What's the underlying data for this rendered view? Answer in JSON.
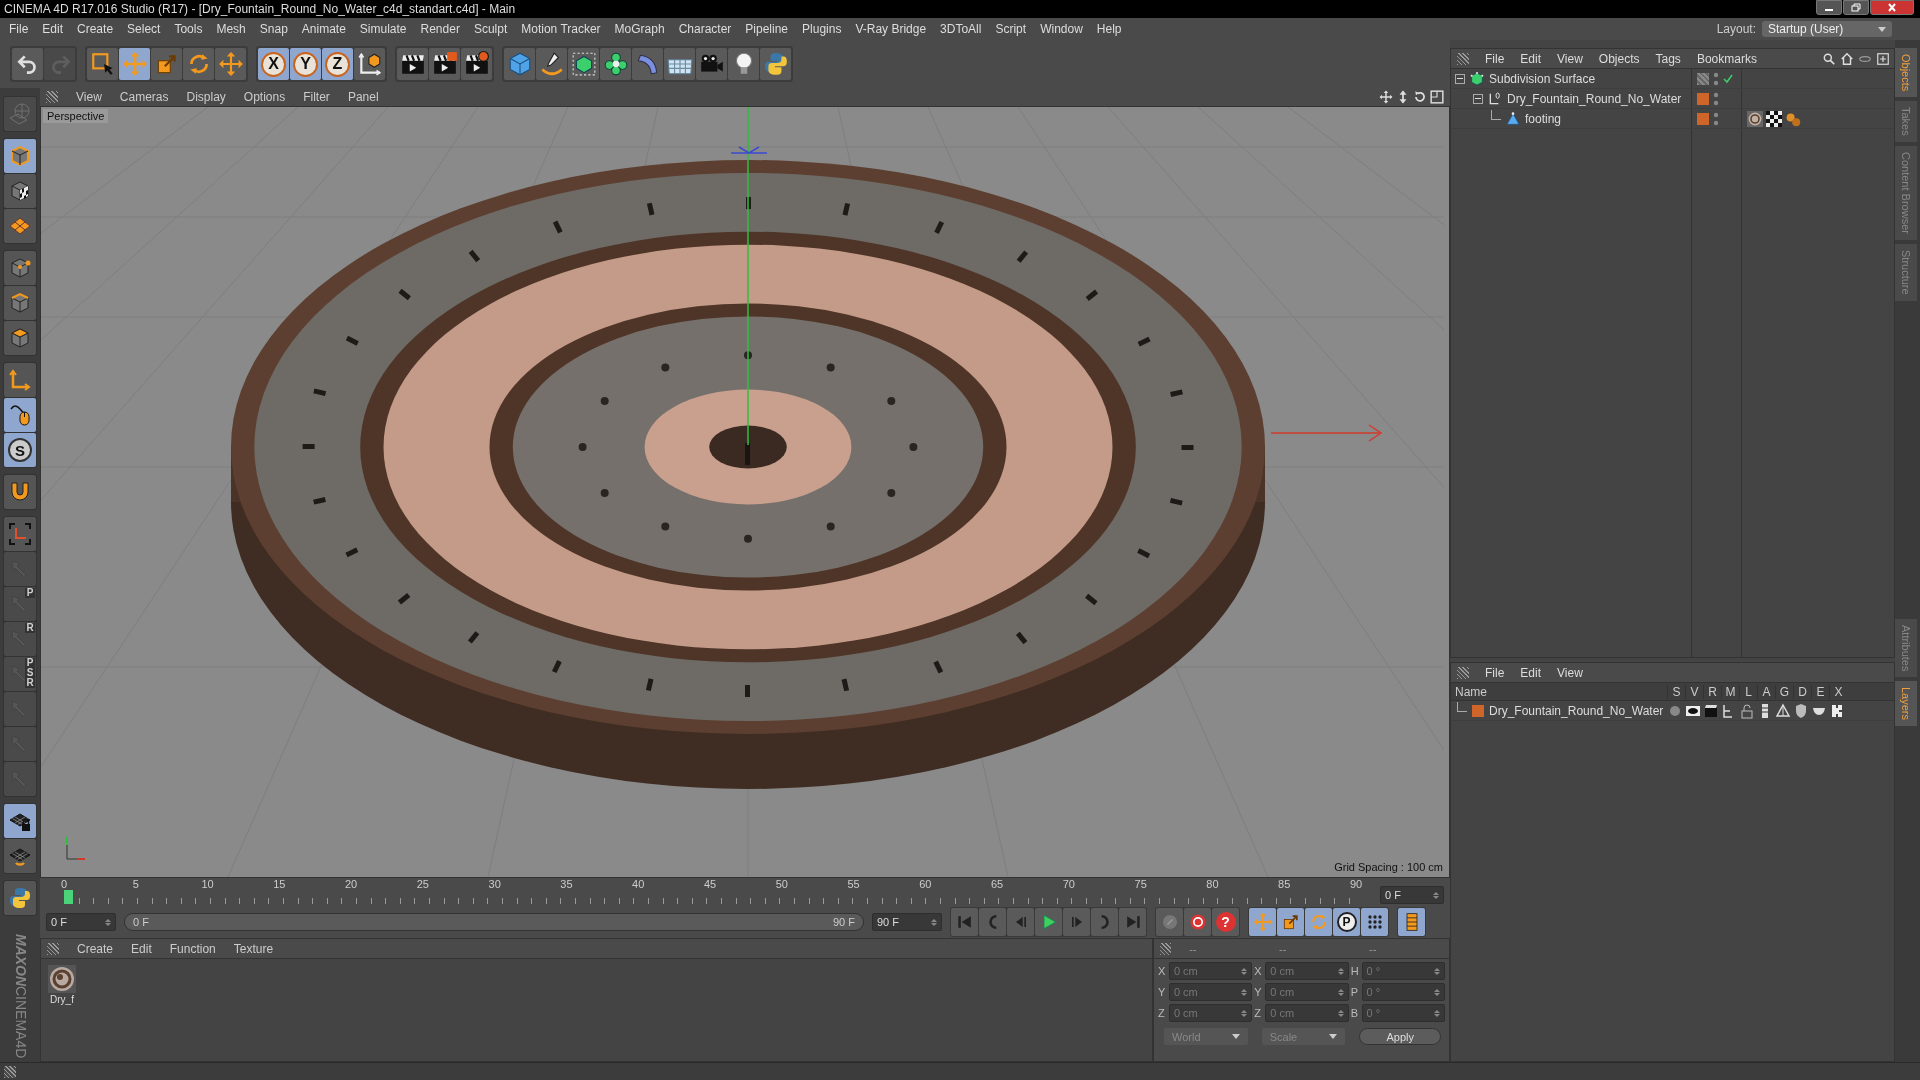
{
  "window": {
    "title": "CINEMA 4D R17.016 Studio (R17) - [Dry_Fountain_Round_No_Water_c4d_standart.c4d] - Main"
  },
  "menu_bar": [
    "File",
    "Edit",
    "Create",
    "Select",
    "Tools",
    "Mesh",
    "Snap",
    "Animate",
    "Simulate",
    "Render",
    "Sculpt",
    "Motion Tracker",
    "MoGraph",
    "Character",
    "Pipeline",
    "Plugins",
    "V-Ray Bridge",
    "3DToAll",
    "Script",
    "Window",
    "Help"
  ],
  "layout": {
    "label": "Layout:",
    "value": "Startup (User)"
  },
  "toolbar": {
    "groups": [
      [
        {
          "kind": "undo",
          "selected": false,
          "disabled": false
        },
        {
          "kind": "redo",
          "selected": false,
          "disabled": true
        }
      ],
      [
        {
          "kind": "select",
          "selected": false,
          "disabled": false
        },
        {
          "kind": "move",
          "selected": true,
          "disabled": false
        },
        {
          "kind": "scale",
          "selected": false,
          "disabled": false
        },
        {
          "kind": "rotate",
          "selected": false,
          "disabled": false
        },
        {
          "kind": "transform",
          "selected": false,
          "disabled": false
        }
      ],
      [
        {
          "kind": "axis",
          "label": "X",
          "selected": true,
          "disabled": false
        },
        {
          "kind": "axis",
          "label": "Y",
          "selected": true,
          "disabled": false
        },
        {
          "kind": "axis",
          "label": "Z",
          "selected": true,
          "disabled": false
        },
        {
          "kind": "coord",
          "selected": false,
          "disabled": false
        }
      ],
      [
        {
          "kind": "render",
          "selected": false,
          "disabled": false
        },
        {
          "kind": "render_pv",
          "selected": false,
          "disabled": false
        },
        {
          "kind": "render_settings",
          "selected": false,
          "disabled": false
        }
      ],
      [
        {
          "kind": "cube",
          "selected": false,
          "disabled": false
        },
        {
          "kind": "pen",
          "selected": false,
          "disabled": false
        },
        {
          "kind": "subdiv",
          "selected": false,
          "disabled": false
        },
        {
          "kind": "cloner",
          "selected": false,
          "disabled": false
        },
        {
          "kind": "bend",
          "selected": false,
          "disabled": false
        },
        {
          "kind": "floor",
          "selected": false,
          "disabled": false
        },
        {
          "kind": "camera",
          "selected": false,
          "disabled": false
        },
        {
          "kind": "light",
          "selected": false,
          "disabled": false
        },
        {
          "kind": "python",
          "selected": false,
          "disabled": false
        }
      ]
    ]
  },
  "left_toolbar": {
    "groups": [
      [
        {
          "kind": "globe",
          "selected": false,
          "disabled": true
        }
      ],
      [
        {
          "kind": "model",
          "selected": true,
          "disabled": false
        },
        {
          "kind": "texture",
          "selected": false,
          "disabled": false
        },
        {
          "kind": "workplane",
          "selected": false,
          "disabled": false
        }
      ],
      [
        {
          "kind": "points",
          "selected": false,
          "disabled": false
        },
        {
          "kind": "edges",
          "selected": false,
          "disabled": false
        },
        {
          "kind": "polys",
          "selected": false,
          "disabled": false
        }
      ],
      [
        {
          "kind": "axis_l",
          "selected": false,
          "disabled": false
        },
        {
          "kind": "mouse",
          "selected": true,
          "disabled": false
        },
        {
          "kind": "snap",
          "label": "S",
          "selected": true,
          "disabled": false
        }
      ],
      [
        {
          "kind": "magnet",
          "selected": false,
          "disabled": false
        }
      ],
      [
        {
          "kind": "axis_frame",
          "selected": false,
          "disabled": false
        },
        {
          "kind": "tool",
          "selected": false,
          "disabled": true
        },
        {
          "kind": "tool",
          "label": "P",
          "selected": false,
          "disabled": true
        },
        {
          "kind": "tool",
          "label": "R",
          "selected": false,
          "disabled": true
        },
        {
          "kind": "tool",
          "label": "PSR",
          "selected": false,
          "disabled": true
        },
        {
          "kind": "tool",
          "selected": false,
          "disabled": true
        },
        {
          "kind": "tool",
          "selected": false,
          "disabled": true
        },
        {
          "kind": "tool",
          "selected": false,
          "disabled": true
        }
      ],
      [
        {
          "kind": "grid_lock",
          "selected": true,
          "disabled": false
        },
        {
          "kind": "grid_rotate",
          "selected": false,
          "disabled": false
        }
      ],
      [
        {
          "kind": "python",
          "selected": false,
          "disabled": false
        }
      ]
    ]
  },
  "logo": [
    "MAXON",
    "CINEMA4D"
  ],
  "viewport": {
    "menu": [
      "View",
      "Cameras",
      "Display",
      "Options",
      "Filter",
      "Panel"
    ],
    "camera": "Perspective",
    "grid_spacing": "Grid Spacing : 100 cm"
  },
  "timeline": {
    "ticks": [
      "0",
      "5",
      "10",
      "15",
      "20",
      "25",
      "30",
      "35",
      "40",
      "45",
      "50",
      "55",
      "60",
      "65",
      "70",
      "75",
      "80",
      "85",
      "90"
    ],
    "level": 0,
    "current": "0 F"
  },
  "transport": {
    "start": "0 F",
    "range_start": "0 F",
    "range_end": "90 F",
    "level": 1,
    "end": "90 F",
    "groups": [
      [
        {
          "kind": "first",
          "selected": false
        },
        {
          "kind": "prevkey",
          "selected": false
        },
        {
          "kind": "prev",
          "selected": false
        },
        {
          "kind": "play",
          "selected": false
        },
        {
          "kind": "next",
          "selected": false
        },
        {
          "kind": "nextkey",
          "selected": false
        },
        {
          "kind": "last",
          "selected": false
        }
      ],
      [
        {
          "kind": "record",
          "selected": false
        },
        {
          "kind": "autokey",
          "selected": false
        },
        {
          "kind": "help",
          "label": "?",
          "selected": false
        }
      ],
      [
        {
          "kind": "move",
          "selected": true
        },
        {
          "kind": "scale",
          "selected": true
        },
        {
          "kind": "rotate",
          "selected": true
        },
        {
          "kind": "param",
          "label": "P",
          "selected": true
        },
        {
          "kind": "dots",
          "selected": true
        }
      ],
      [
        {
          "kind": "timeline",
          "selected": true
        }
      ]
    ]
  },
  "material_manager": {
    "menu": [
      "Create",
      "Edit",
      "Function",
      "Texture"
    ],
    "materials": [
      {
        "name": "Dry_f"
      }
    ]
  },
  "coordinates": {
    "headers": [
      "--",
      "--",
      "--"
    ],
    "rows": [
      [
        {
          "label": "X",
          "value": "0 cm"
        },
        {
          "label": "X",
          "value": "0 cm"
        },
        {
          "label": "H",
          "value": "0 °"
        }
      ],
      [
        {
          "label": "Y",
          "value": "0 cm"
        },
        {
          "label": "Y",
          "value": "0 cm"
        },
        {
          "label": "P",
          "value": "0 °"
        }
      ],
      [
        {
          "label": "Z",
          "value": "0 cm"
        },
        {
          "label": "Z",
          "value": "0 cm"
        },
        {
          "label": "B",
          "value": "0 °"
        }
      ]
    ],
    "dropdowns": [
      "World",
      "Scale"
    ],
    "apply": "Apply"
  },
  "object_manager": {
    "menu": [
      "File",
      "Edit",
      "View",
      "Objects",
      "Tags",
      "Bookmarks"
    ],
    "objects": [
      {
        "name": "Subdivision Surface",
        "kind": "subdivision",
        "expanded": true,
        "enabled": true,
        "children": [
          {
            "name": "Dry_Fountain_Round_No_Water",
            "kind": "null",
            "expanded": true,
            "color": "#d0652a",
            "children": [
              {
                "name": "footing",
                "kind": "polygon",
                "color": "#d0652a",
                "tags": [
                  {
                    "kind": "material"
                  },
                  {
                    "kind": "checker"
                  },
                  {
                    "kind": "phong"
                  }
                ]
              }
            ]
          }
        ]
      }
    ]
  },
  "layers": {
    "menu": [
      "File",
      "Edit",
      "View"
    ],
    "columns": [
      "Name",
      "S",
      "V",
      "R",
      "M",
      "L",
      "A",
      "G",
      "D",
      "E",
      "X"
    ],
    "rows": [
      {
        "name": "Dry_Fountain_Round_No_Water",
        "color": "#d0652a"
      }
    ]
  },
  "side_tabs": {
    "top": [
      {
        "label": "Objects",
        "selected": true
      },
      {
        "label": "Takes",
        "selected": false
      },
      {
        "label": "Content Browser",
        "selected": false
      },
      {
        "label": "Structure",
        "selected": false
      }
    ],
    "bottom": [
      {
        "label": "Attributes",
        "selected": false
      },
      {
        "label": "Layers",
        "selected": true
      }
    ]
  }
}
